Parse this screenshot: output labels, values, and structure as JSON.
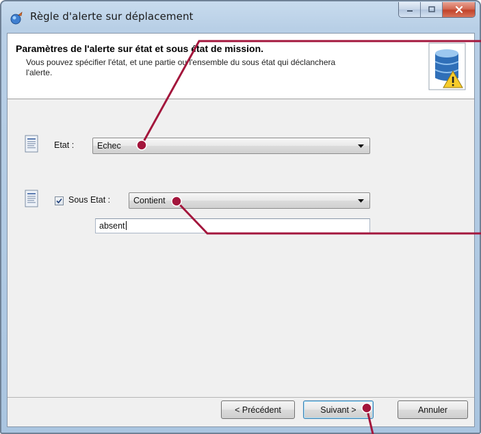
{
  "window": {
    "title": "Règle d'alerte sur déplacement"
  },
  "header": {
    "title": "Paramètres de l'alerte sur état et sous état de mission.",
    "description": "Vous pouvez spécifier l'état, et une partie ou l'ensemble du sous état qui déclanchera l'alerte."
  },
  "etat": {
    "label": "Etat :",
    "value": "Echec"
  },
  "sous_etat": {
    "checked": true,
    "label": "Sous Etat :",
    "mode": "Contient",
    "text_value": "absent"
  },
  "buttons": {
    "previous": "< Précédent",
    "next": "Suivant >",
    "cancel": "Annuler"
  },
  "colors": {
    "annotation": "#a3163c",
    "titlebar": "#b8cfe6",
    "close_button": "#c2432a"
  }
}
